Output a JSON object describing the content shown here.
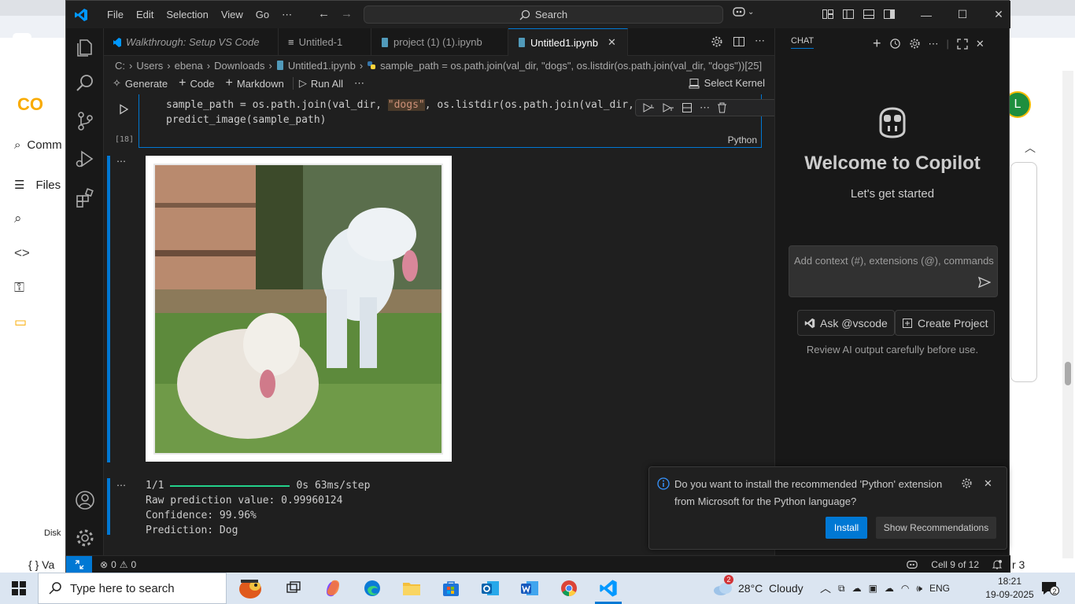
{
  "browser_bg": {
    "colab_logo": "CO",
    "command_palette": "Comm",
    "files_label": "Files",
    "disk_label": "Disk",
    "variables_label": "Va",
    "avatar_letter": "L",
    "terminal_label": "r 3"
  },
  "titlebar": {
    "menu": [
      "File",
      "Edit",
      "Selection",
      "View",
      "Go",
      "⋯"
    ],
    "search": "Search"
  },
  "tabs": [
    {
      "label": "Walkthrough: Setup VS Code"
    },
    {
      "label": "Untitled-1"
    },
    {
      "label": "project (1) (1).ipynb"
    },
    {
      "label": "Untitled1.ipynb"
    }
  ],
  "breadcrumb": [
    "C:",
    "Users",
    "ebena",
    "Downloads",
    "Untitled1.ipynb",
    "sample_path = os.path.join(val_dir, \"dogs\", os.listdir(os.path.join(val_dir, \"dogs\"))[25]"
  ],
  "notebook_toolbar": {
    "generate": "Generate",
    "code": "Code",
    "markdown": "Markdown",
    "run_all": "Run All",
    "more": "⋯",
    "kernel": "Select Kernel"
  },
  "cell": {
    "exec_count": "[18]",
    "line1_pre": "sample_path = os.path.join(val_dir, ",
    "line1_str": "\"dogs\"",
    "line1_post": ", os.listdir(os.path.join(val_dir, ",
    "line2": "predict_image(sample_path)",
    "language": "Python"
  },
  "output": {
    "progress_left": "1/1",
    "progress_right": "0s 63ms/step",
    "raw_prediction": "Raw prediction value: 0.99960124",
    "confidence": "Confidence: 99.96%",
    "prediction": "Prediction: Dog"
  },
  "chat": {
    "title": "CHAT",
    "welcome_title": "Welcome to Copilot",
    "welcome_sub": "Let's get started",
    "input_placeholder": "Add context (#), extensions (@), commands",
    "ask_button": "Ask @vscode",
    "create_button": "Create Project",
    "review_note": "Review AI output carefully before use."
  },
  "toast": {
    "message": "Do you want to install the recommended 'Python' extension from Microsoft for the Python language?",
    "install": "Install",
    "show_recommendations": "Show Recommendations"
  },
  "statusbar": {
    "errors": "0",
    "warnings": "0",
    "cell_position": "Cell 9 of 12"
  },
  "taskbar": {
    "search_placeholder": "Type here to search",
    "weather": "28°C  Cloudy",
    "weather_badge": "2",
    "language": "ENG",
    "time": "18:21",
    "date": "19-09-2025",
    "notifications": "2"
  },
  "colors": {
    "accent": "#0078d4",
    "editor_bg": "#1f1f1f",
    "sidebar_bg": "#181818",
    "progress": "#23d18b",
    "string": "#ce9178"
  }
}
